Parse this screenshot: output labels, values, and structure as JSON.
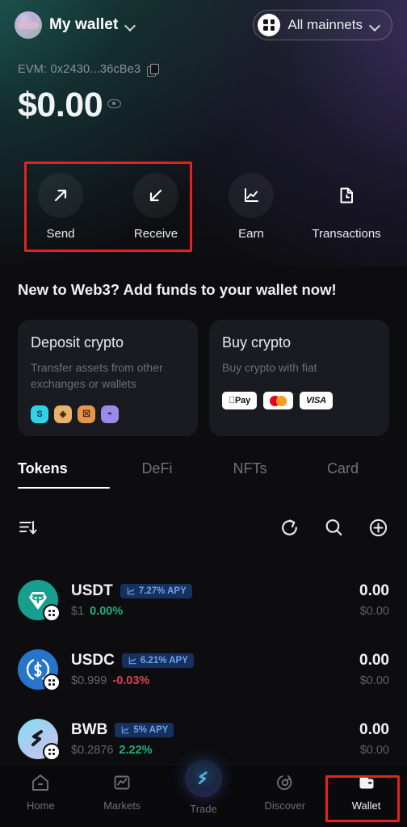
{
  "header": {
    "wallet_name": "My wallet",
    "wallet_chevron": "chevron-down-icon",
    "network_label": "All mainnets",
    "network_chevron": "chevron-down-icon"
  },
  "account": {
    "address_label": "EVM: 0x2430...36cBe3",
    "copy_icon": "copy-icon",
    "balance": "$0.00",
    "eye_icon": "eye-icon"
  },
  "quick_actions": [
    {
      "label": "Send",
      "icon": "arrow-up-right-icon"
    },
    {
      "label": "Receive",
      "icon": "arrow-down-left-icon"
    },
    {
      "label": "Earn",
      "icon": "chart-line-icon"
    },
    {
      "label": "Transactions",
      "icon": "document-clock-icon"
    }
  ],
  "promo": {
    "title": "New to Web3? Add funds to your wallet now!",
    "deposit_card": {
      "title": "Deposit crypto",
      "subtitle": "Transfer assets from other exchanges or wallets",
      "exchanges": [
        {
          "name": "exchange-badge-1",
          "bg": "#2fd3e8",
          "fg": "#11324a",
          "glyph": "S"
        },
        {
          "name": "exchange-badge-2",
          "bg": "#e8b06a",
          "fg": "#3a2a12",
          "glyph": "◈"
        },
        {
          "name": "exchange-badge-3",
          "bg": "#e8954a",
          "fg": "#3a2210",
          "glyph": "☒"
        },
        {
          "name": "exchange-badge-4",
          "bg": "#9b8ae8",
          "fg": "#241c4a",
          "glyph": "◔"
        }
      ]
    },
    "buy_card": {
      "title": "Buy crypto",
      "subtitle": "Buy crypto with fiat",
      "methods": [
        {
          "name": "apple-pay-badge",
          "label": "Pay"
        },
        {
          "name": "mastercard-badge",
          "label": ""
        },
        {
          "name": "visa-badge",
          "label": "VISA"
        }
      ]
    }
  },
  "tabs": [
    {
      "label": "Tokens",
      "active": true
    },
    {
      "label": "DeFi",
      "active": false
    },
    {
      "label": "NFTs",
      "active": false
    },
    {
      "label": "Card",
      "active": false
    }
  ],
  "tools": {
    "sort_icon": "sort-descending-icon",
    "refresh_icon": "refresh-icon",
    "search_icon": "search-icon",
    "add_icon": "plus-circle-icon"
  },
  "tokens": [
    {
      "symbol": "USDT",
      "apy": "7.27% APY",
      "apy_icon": "chart-line-icon",
      "price": "$1",
      "change": "0.00%",
      "change_dir": "flat",
      "balance": "0.00",
      "fiat": "$0.00",
      "icon_name": "usdt-icon",
      "icon_bg": "#179e8e",
      "chain_badge": "chain-grid-badge"
    },
    {
      "symbol": "USDC",
      "apy": "6.21% APY",
      "apy_icon": "chart-line-icon",
      "price": "$0.999",
      "change": "-0.03%",
      "change_dir": "down",
      "balance": "0.00",
      "fiat": "$0.00",
      "icon_name": "usdc-icon",
      "icon_bg": "#2775ca",
      "chain_badge": "chain-grid-badge"
    },
    {
      "symbol": "BWB",
      "apy": "5% APY",
      "apy_icon": "chart-line-icon",
      "price": "$0.2876",
      "change": "2.22%",
      "change_dir": "up",
      "balance": "0.00",
      "fiat": "$0.00",
      "icon_name": "bwb-icon",
      "icon_bg": "#8fd8e8",
      "chain_badge": "chain-grid-badge"
    }
  ],
  "bottom_nav": [
    {
      "label": "Home",
      "icon": "home-icon",
      "active": false
    },
    {
      "label": "Markets",
      "icon": "chart-square-icon",
      "active": false
    },
    {
      "label": "Trade",
      "icon": "trade-orb-icon",
      "active": false
    },
    {
      "label": "Discover",
      "icon": "compass-icon",
      "active": false
    },
    {
      "label": "Wallet",
      "icon": "wallet-icon",
      "active": true
    }
  ],
  "highlights": [
    {
      "name": "send-receive-highlight",
      "color": "#e8201f"
    },
    {
      "name": "wallet-nav-highlight",
      "color": "#e8201f"
    }
  ]
}
